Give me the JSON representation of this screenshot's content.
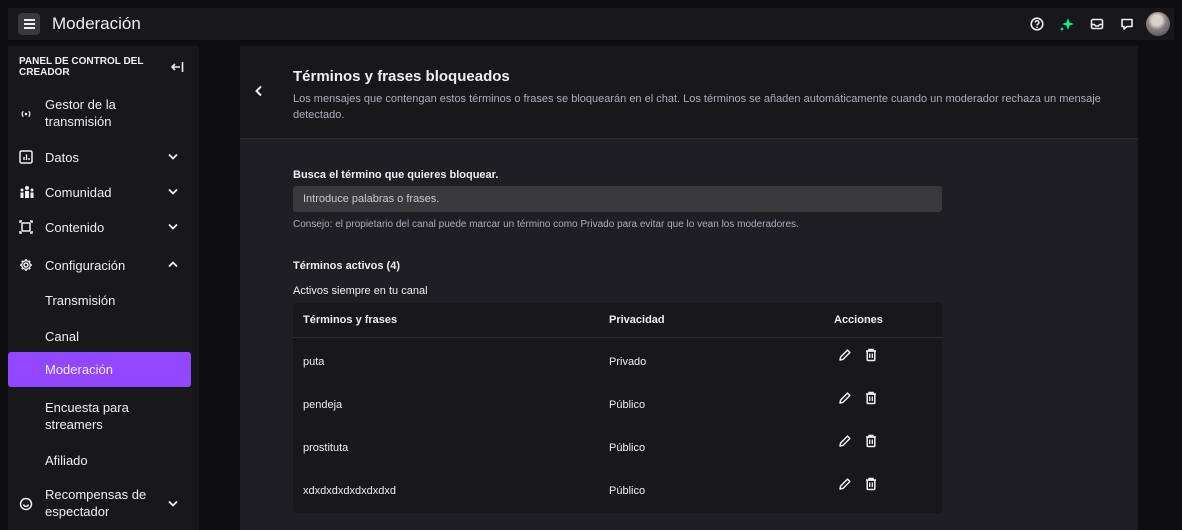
{
  "app": {
    "title": "Moderación"
  },
  "topbar": {
    "icons": [
      "help-icon",
      "sparkle-icon",
      "inbox-icon",
      "chat-icon",
      "avatar"
    ],
    "accent": "#00f593"
  },
  "sidebar": {
    "header": "PANEL DE CONTROL DEL CREADOR",
    "items": [
      {
        "label": "Gestor de la transmisión",
        "icon": "broadcast-icon"
      },
      {
        "label": "Datos",
        "icon": "chart-icon"
      },
      {
        "label": "Comunidad",
        "icon": "community-icon"
      },
      {
        "label": "Contenido",
        "icon": "content-icon"
      },
      {
        "label": "Configuración",
        "icon": "gear-icon"
      }
    ],
    "subitems": [
      {
        "label": "Transmisión"
      },
      {
        "label": "Canal"
      },
      {
        "label": "Moderación"
      },
      {
        "label": "Encuesta para streamers"
      },
      {
        "label": "Afiliado"
      }
    ],
    "rewards": {
      "label": "Recompensas de espectador",
      "icon": "rewards-icon"
    },
    "active_color": "#9147ff"
  },
  "panel": {
    "title": "Términos y frases bloqueados",
    "description": "Los mensajes que contengan estos términos o frases se bloquearán en el chat. Los términos se añaden automáticamente cuando un moderador rechaza un mensaje detectado.",
    "search_label": "Busca el término que quieres bloquear.",
    "search_placeholder": "Introduce palabras o frases.",
    "tip": "Consejo: el propietario del canal puede marcar un término como Privado para evitar que lo vean los moderadores.",
    "active_title": "Términos activos (4)",
    "active_sub": "Activos siempre en tu canal",
    "table": {
      "headers": [
        "Términos y frases",
        "Privacidad",
        "Acciones"
      ],
      "rows": [
        {
          "term": "puta",
          "privacy": "Privado"
        },
        {
          "term": "pendeja",
          "privacy": "Público"
        },
        {
          "term": "prostituta",
          "privacy": "Público"
        },
        {
          "term": "xdxdxdxdxdxdxdxd",
          "privacy": "Público"
        }
      ]
    }
  }
}
